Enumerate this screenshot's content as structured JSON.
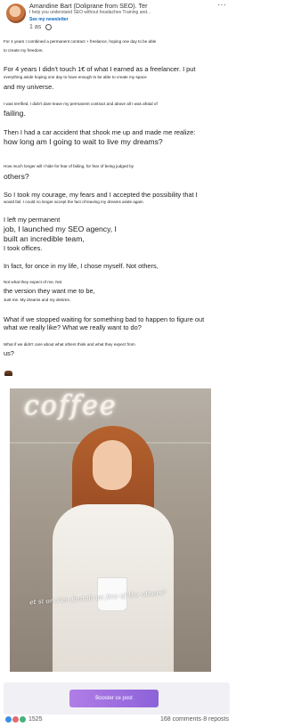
{
  "post": {
    "author": "Amandine Bart (Doliprane from SEO). Ter",
    "headline": "I help you understand SEO without headaches Training and...",
    "newsletter": "See my newsletter",
    "time": "1 as",
    "more": "···"
  },
  "lines": [
    "For 4 years I combined a permanent contract + freelance, hoping one day to be able",
    "to create my freedom.",
    "For 4 years I didn't touch 1€ of what I earned as a freelancer. I put",
    "everything aside hoping one day to have enough to be able to create my space",
    "and my universe.",
    "I was terrified, I didn't dare leave my permanent contract and above all I was afraid of",
    "failing.",
    "Then I had a car accident that shook me up and made me realize:",
    "how long am I going to wait to live my dreams?",
    "How much longer will I hide for fear of failing, for fear of being judged by",
    "others?",
    "So I took my courage, my fears and I accepted the possibility that I",
    "would fail. I could no longer accept the fact of leaving my dreams aside again.",
    "I left my permanent",
    "job, I launched my SEO agency, I",
    "built an incredible team,",
    "I took offices.",
    "In fact, for once in my life, I chose myself. Not others,",
    "Not what they expect of me, Not",
    "the version they want me to be,",
    "Just me. My dreams and my desires.",
    "What if we stopped waiting for something bad to happen to figure out",
    "what we really like? What we really want to do?",
    "What if we didn't care about what others think and what they expect from",
    "us?"
  ],
  "image": {
    "neon_sign": "coffee",
    "overlay": "et si on s'en foutait un  few of the others?"
  },
  "boost": {
    "label": "Booster ce post"
  },
  "footer": {
    "reactions_count": "1525",
    "stats": "168 comments·8 reposts"
  },
  "colors": {
    "accent": "#0a66c2",
    "boost": "#9b6fe0"
  }
}
